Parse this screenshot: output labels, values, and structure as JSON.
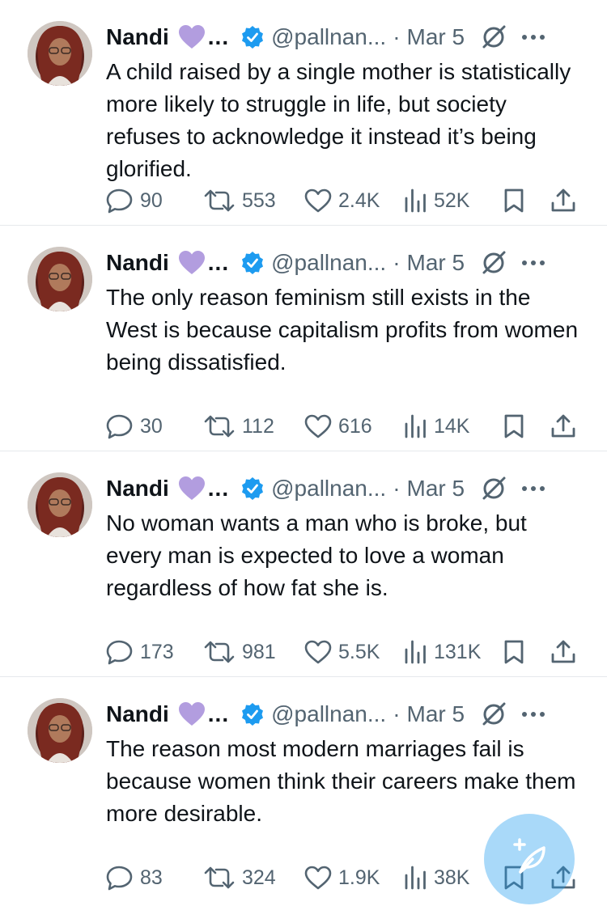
{
  "colors": {
    "accent": "#1d9bf0",
    "text": "#0f1419",
    "muted": "#536471",
    "heart": "#b29ddf",
    "divider": "#e6e9ec"
  },
  "icons": {
    "purple_heart": "purple-heart-icon",
    "verified": "verified-badge-icon",
    "grok": "grok-icon",
    "more": "more-icon",
    "reply": "reply-icon",
    "retweet": "retweet-icon",
    "like": "like-icon",
    "views": "views-icon",
    "bookmark": "bookmark-icon",
    "share": "share-icon",
    "compose": "compose-post-icon"
  },
  "tweets": [
    {
      "name": "Nandi",
      "ellipsis": "...",
      "handle": "@pallnan...",
      "separator": "·",
      "date": "Mar 5",
      "text": "A child raised by a single mother is statistically more likely to struggle in life, but society refuses to acknowledge it instead it’s being glorified.",
      "replies": "90",
      "retweets": "553",
      "likes": "2.4K",
      "views": "52K"
    },
    {
      "name": "Nandi",
      "ellipsis": "...",
      "handle": "@pallnan...",
      "separator": "·",
      "date": "Mar 5",
      "text": "The only reason feminism still exists in the West is because capitalism profits from women being dissatisfied.",
      "replies": "30",
      "retweets": "112",
      "likes": "616",
      "views": "14K"
    },
    {
      "name": "Nandi",
      "ellipsis": "...",
      "handle": "@pallnan...",
      "separator": "·",
      "date": "Mar 5",
      "text": "No woman wants a man who is broke, but every man is expected to love a woman regardless of how fat she is.",
      "replies": "173",
      "retweets": "981",
      "likes": "5.5K",
      "views": "131K"
    },
    {
      "name": "Nandi",
      "ellipsis": "...",
      "handle": "@pallnan...",
      "separator": "·",
      "date": "Mar 5",
      "text": "The reason most modern marriages fail is because women think their careers make them more desirable.",
      "replies": "83",
      "retweets": "324",
      "likes": "1.9K",
      "views": "38K"
    }
  ]
}
